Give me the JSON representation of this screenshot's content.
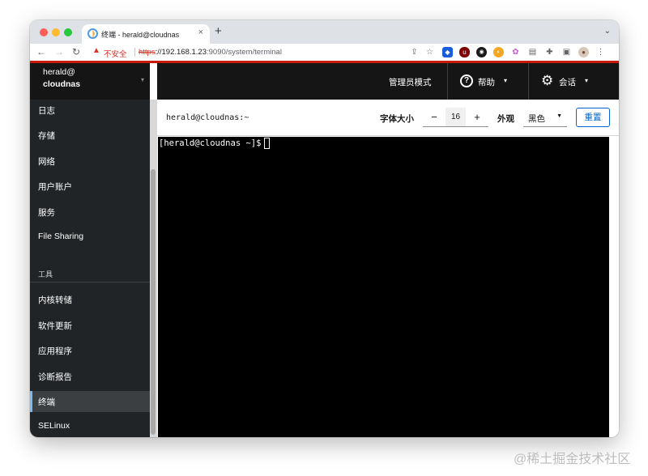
{
  "browser": {
    "tab_title": "终端 - herald@cloudnas",
    "tab_close": "×",
    "new_tab": "+",
    "tab_search": "⌄",
    "nav_back": "←",
    "nav_forward": "→",
    "nav_reload": "↻",
    "security_icon": "▲",
    "security_label": "不安全",
    "url_scheme": "https",
    "url_host": "://192.168.1.23",
    "url_rest": ":9090/system/terminal",
    "toolbar_icons": [
      "share-icon",
      "bookmark-star-icon",
      "bitwarden-icon",
      "ublock-icon",
      "extension-icon",
      "extension-icon",
      "extension-icon",
      "document-icon",
      "puzzle-icon",
      "sidepanel-icon",
      "profile-avatar",
      "more-menu-icon"
    ],
    "accent_color": "#c9190b"
  },
  "host": {
    "user": "herald@",
    "name": "cloudnas",
    "caret": "▾"
  },
  "sidebar": {
    "items": [
      {
        "label": "日志"
      },
      {
        "label": "存储"
      },
      {
        "label": "网络"
      },
      {
        "label": "用户账户"
      },
      {
        "label": "服务"
      },
      {
        "label": "File Sharing"
      }
    ],
    "tools_heading": "工具",
    "tools": [
      {
        "label": "内核转储"
      },
      {
        "label": "软件更新"
      },
      {
        "label": "应用程序"
      },
      {
        "label": "诊断报告"
      },
      {
        "label": "终端",
        "active": true
      },
      {
        "label": "SELinux"
      }
    ]
  },
  "masthead": {
    "admin_mode": "管理员模式",
    "help_icon": "?",
    "help_label": "帮助",
    "session_icon": "⚙",
    "session_label": "会话",
    "caret": "▾"
  },
  "terminal": {
    "title": "herald@cloudnas:~",
    "font_size_label": "字体大小",
    "minus": "−",
    "font_size": "16",
    "plus": "+",
    "appearance_label": "外观",
    "appearance_value": "黑色",
    "appearance_caret": "▼",
    "reset_label": "重置",
    "prompt": "[herald@cloudnas ~]$ "
  },
  "watermark": "@稀土掘金技术社区"
}
